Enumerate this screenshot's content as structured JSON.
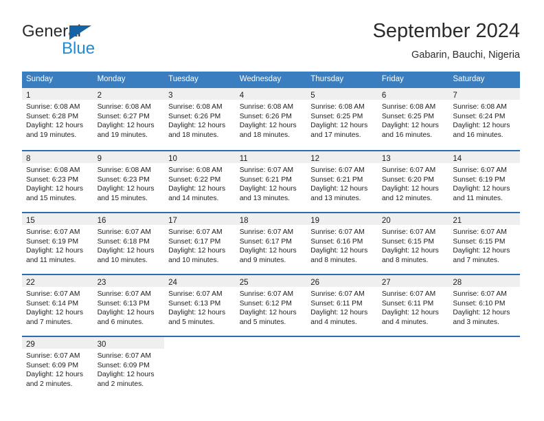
{
  "brand": {
    "name_part1": "General",
    "name_part2": "Blue",
    "flag_icon": "triangle-flag-icon",
    "accent_dark": "#1464a5",
    "accent_light": "#1e8bd4"
  },
  "header": {
    "title": "September 2024",
    "location": "Gabarin, Bauchi, Nigeria"
  },
  "colors": {
    "header_row_bg": "#3a7ebf",
    "daynum_band_bg": "#efefef",
    "row_separator": "#2b6cb0",
    "text": "#1c1c1c"
  },
  "weekday_headers": [
    "Sunday",
    "Monday",
    "Tuesday",
    "Wednesday",
    "Thursday",
    "Friday",
    "Saturday"
  ],
  "weeks": [
    [
      {
        "day": "1",
        "sunrise": "Sunrise: 6:08 AM",
        "sunset": "Sunset: 6:28 PM",
        "daylight1": "Daylight: 12 hours",
        "daylight2": "and 19 minutes."
      },
      {
        "day": "2",
        "sunrise": "Sunrise: 6:08 AM",
        "sunset": "Sunset: 6:27 PM",
        "daylight1": "Daylight: 12 hours",
        "daylight2": "and 19 minutes."
      },
      {
        "day": "3",
        "sunrise": "Sunrise: 6:08 AM",
        "sunset": "Sunset: 6:26 PM",
        "daylight1": "Daylight: 12 hours",
        "daylight2": "and 18 minutes."
      },
      {
        "day": "4",
        "sunrise": "Sunrise: 6:08 AM",
        "sunset": "Sunset: 6:26 PM",
        "daylight1": "Daylight: 12 hours",
        "daylight2": "and 18 minutes."
      },
      {
        "day": "5",
        "sunrise": "Sunrise: 6:08 AM",
        "sunset": "Sunset: 6:25 PM",
        "daylight1": "Daylight: 12 hours",
        "daylight2": "and 17 minutes."
      },
      {
        "day": "6",
        "sunrise": "Sunrise: 6:08 AM",
        "sunset": "Sunset: 6:25 PM",
        "daylight1": "Daylight: 12 hours",
        "daylight2": "and 16 minutes."
      },
      {
        "day": "7",
        "sunrise": "Sunrise: 6:08 AM",
        "sunset": "Sunset: 6:24 PM",
        "daylight1": "Daylight: 12 hours",
        "daylight2": "and 16 minutes."
      }
    ],
    [
      {
        "day": "8",
        "sunrise": "Sunrise: 6:08 AM",
        "sunset": "Sunset: 6:23 PM",
        "daylight1": "Daylight: 12 hours",
        "daylight2": "and 15 minutes."
      },
      {
        "day": "9",
        "sunrise": "Sunrise: 6:08 AM",
        "sunset": "Sunset: 6:23 PM",
        "daylight1": "Daylight: 12 hours",
        "daylight2": "and 15 minutes."
      },
      {
        "day": "10",
        "sunrise": "Sunrise: 6:08 AM",
        "sunset": "Sunset: 6:22 PM",
        "daylight1": "Daylight: 12 hours",
        "daylight2": "and 14 minutes."
      },
      {
        "day": "11",
        "sunrise": "Sunrise: 6:07 AM",
        "sunset": "Sunset: 6:21 PM",
        "daylight1": "Daylight: 12 hours",
        "daylight2": "and 13 minutes."
      },
      {
        "day": "12",
        "sunrise": "Sunrise: 6:07 AM",
        "sunset": "Sunset: 6:21 PM",
        "daylight1": "Daylight: 12 hours",
        "daylight2": "and 13 minutes."
      },
      {
        "day": "13",
        "sunrise": "Sunrise: 6:07 AM",
        "sunset": "Sunset: 6:20 PM",
        "daylight1": "Daylight: 12 hours",
        "daylight2": "and 12 minutes."
      },
      {
        "day": "14",
        "sunrise": "Sunrise: 6:07 AM",
        "sunset": "Sunset: 6:19 PM",
        "daylight1": "Daylight: 12 hours",
        "daylight2": "and 11 minutes."
      }
    ],
    [
      {
        "day": "15",
        "sunrise": "Sunrise: 6:07 AM",
        "sunset": "Sunset: 6:19 PM",
        "daylight1": "Daylight: 12 hours",
        "daylight2": "and 11 minutes."
      },
      {
        "day": "16",
        "sunrise": "Sunrise: 6:07 AM",
        "sunset": "Sunset: 6:18 PM",
        "daylight1": "Daylight: 12 hours",
        "daylight2": "and 10 minutes."
      },
      {
        "day": "17",
        "sunrise": "Sunrise: 6:07 AM",
        "sunset": "Sunset: 6:17 PM",
        "daylight1": "Daylight: 12 hours",
        "daylight2": "and 10 minutes."
      },
      {
        "day": "18",
        "sunrise": "Sunrise: 6:07 AM",
        "sunset": "Sunset: 6:17 PM",
        "daylight1": "Daylight: 12 hours",
        "daylight2": "and 9 minutes."
      },
      {
        "day": "19",
        "sunrise": "Sunrise: 6:07 AM",
        "sunset": "Sunset: 6:16 PM",
        "daylight1": "Daylight: 12 hours",
        "daylight2": "and 8 minutes."
      },
      {
        "day": "20",
        "sunrise": "Sunrise: 6:07 AM",
        "sunset": "Sunset: 6:15 PM",
        "daylight1": "Daylight: 12 hours",
        "daylight2": "and 8 minutes."
      },
      {
        "day": "21",
        "sunrise": "Sunrise: 6:07 AM",
        "sunset": "Sunset: 6:15 PM",
        "daylight1": "Daylight: 12 hours",
        "daylight2": "and 7 minutes."
      }
    ],
    [
      {
        "day": "22",
        "sunrise": "Sunrise: 6:07 AM",
        "sunset": "Sunset: 6:14 PM",
        "daylight1": "Daylight: 12 hours",
        "daylight2": "and 7 minutes."
      },
      {
        "day": "23",
        "sunrise": "Sunrise: 6:07 AM",
        "sunset": "Sunset: 6:13 PM",
        "daylight1": "Daylight: 12 hours",
        "daylight2": "and 6 minutes."
      },
      {
        "day": "24",
        "sunrise": "Sunrise: 6:07 AM",
        "sunset": "Sunset: 6:13 PM",
        "daylight1": "Daylight: 12 hours",
        "daylight2": "and 5 minutes."
      },
      {
        "day": "25",
        "sunrise": "Sunrise: 6:07 AM",
        "sunset": "Sunset: 6:12 PM",
        "daylight1": "Daylight: 12 hours",
        "daylight2": "and 5 minutes."
      },
      {
        "day": "26",
        "sunrise": "Sunrise: 6:07 AM",
        "sunset": "Sunset: 6:11 PM",
        "daylight1": "Daylight: 12 hours",
        "daylight2": "and 4 minutes."
      },
      {
        "day": "27",
        "sunrise": "Sunrise: 6:07 AM",
        "sunset": "Sunset: 6:11 PM",
        "daylight1": "Daylight: 12 hours",
        "daylight2": "and 4 minutes."
      },
      {
        "day": "28",
        "sunrise": "Sunrise: 6:07 AM",
        "sunset": "Sunset: 6:10 PM",
        "daylight1": "Daylight: 12 hours",
        "daylight2": "and 3 minutes."
      }
    ],
    [
      {
        "day": "29",
        "sunrise": "Sunrise: 6:07 AM",
        "sunset": "Sunset: 6:09 PM",
        "daylight1": "Daylight: 12 hours",
        "daylight2": "and 2 minutes."
      },
      {
        "day": "30",
        "sunrise": "Sunrise: 6:07 AM",
        "sunset": "Sunset: 6:09 PM",
        "daylight1": "Daylight: 12 hours",
        "daylight2": "and 2 minutes."
      },
      {
        "day": "",
        "sunrise": "",
        "sunset": "",
        "daylight1": "",
        "daylight2": ""
      },
      {
        "day": "",
        "sunrise": "",
        "sunset": "",
        "daylight1": "",
        "daylight2": ""
      },
      {
        "day": "",
        "sunrise": "",
        "sunset": "",
        "daylight1": "",
        "daylight2": ""
      },
      {
        "day": "",
        "sunrise": "",
        "sunset": "",
        "daylight1": "",
        "daylight2": ""
      },
      {
        "day": "",
        "sunrise": "",
        "sunset": "",
        "daylight1": "",
        "daylight2": ""
      }
    ]
  ]
}
